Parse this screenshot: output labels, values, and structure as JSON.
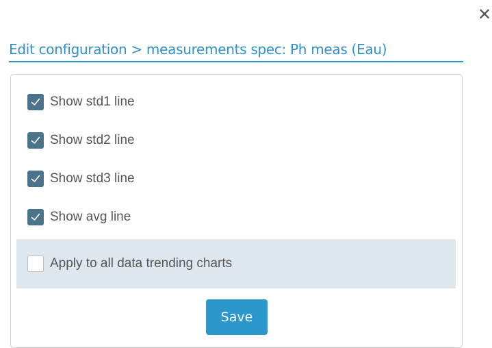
{
  "dialog": {
    "close_glyph": "✕",
    "breadcrumb": "Edit configuration > measurements spec: Ph meas (Eau)"
  },
  "options": [
    {
      "label": "Show std1 line",
      "checked": true
    },
    {
      "label": "Show std2 line",
      "checked": true
    },
    {
      "label": "Show std3 line",
      "checked": true
    },
    {
      "label": "Show avg line",
      "checked": true
    }
  ],
  "apply_all": {
    "label": "Apply to all data trending charts",
    "checked": false
  },
  "save_label": "Save",
  "colors": {
    "accent": "#2f8fc8",
    "checkbox_checked": "#4b7389",
    "band_background": "#dfe7ef",
    "button": "#2c97cf"
  }
}
